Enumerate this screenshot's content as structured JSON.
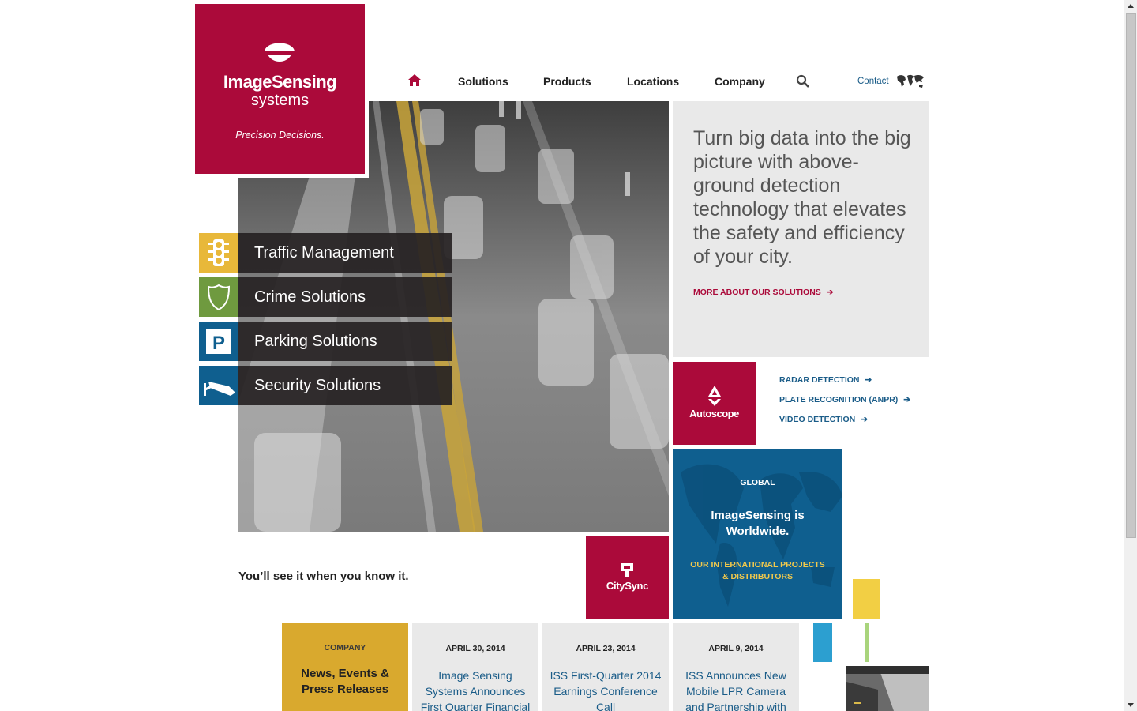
{
  "logo": {
    "brand_line1": "ImageSensing",
    "brand_line2": "systems",
    "tagline": "Precision Decisions."
  },
  "nav": {
    "home_icon": "home-icon",
    "items": [
      "Solutions",
      "Products",
      "Locations",
      "Company"
    ],
    "search_icon": "search-icon",
    "contact_label": "Contact",
    "map_icon": "world-map-icon"
  },
  "solutions": [
    {
      "label": "Traffic Management",
      "icon": "traffic-light-icon",
      "color": "#e8b83a"
    },
    {
      "label": "Crime Solutions",
      "icon": "shield-icon",
      "color": "#6f9a3f"
    },
    {
      "label": "Parking Solutions",
      "icon": "parking-icon",
      "color": "#0f5f8f"
    },
    {
      "label": "Security Solutions",
      "icon": "security-camera-icon",
      "color": "#0f5f8f"
    }
  ],
  "intro": {
    "text": "Turn big data into the big picture with above-ground detection technology that elevates the safety and efficiency of your city.",
    "link": "MORE ABOUT OUR SOLUTIONS"
  },
  "autoscope": {
    "name": "Autoscope",
    "links": [
      "RADAR DETECTION",
      "PLATE RECOGNITION (ANPR)",
      "VIDEO DETECTION"
    ]
  },
  "global": {
    "label": "GLOBAL",
    "heading": "ImageSensing is Worldwide.",
    "link": "OUR INTERNATIONAL PROJECTS & DISTRIBUTORS"
  },
  "citysync": {
    "name": "CitySync"
  },
  "tagline": "You’ll see it when you know it.",
  "news": {
    "company_label": "COMPANY",
    "company_heading": "News, Events & Press Releases",
    "items": [
      {
        "date": "APRIL 30, 2014",
        "title": "Image Sensing Systems Announces First Quarter Financial"
      },
      {
        "date": "APRIL 23, 2014",
        "title": "ISS First-Quarter 2014 Earnings Conference Call"
      },
      {
        "date": "APRIL 9, 2014",
        "title": "ISS Announces New Mobile LPR Camera and Partnership with"
      }
    ]
  },
  "colors": {
    "brand_red": "#ab0a3a",
    "brand_blue": "#0f5f8f",
    "brand_yellow": "#e8b83a",
    "brand_green": "#6f9a3f",
    "link_blue": "#1a5c88"
  }
}
